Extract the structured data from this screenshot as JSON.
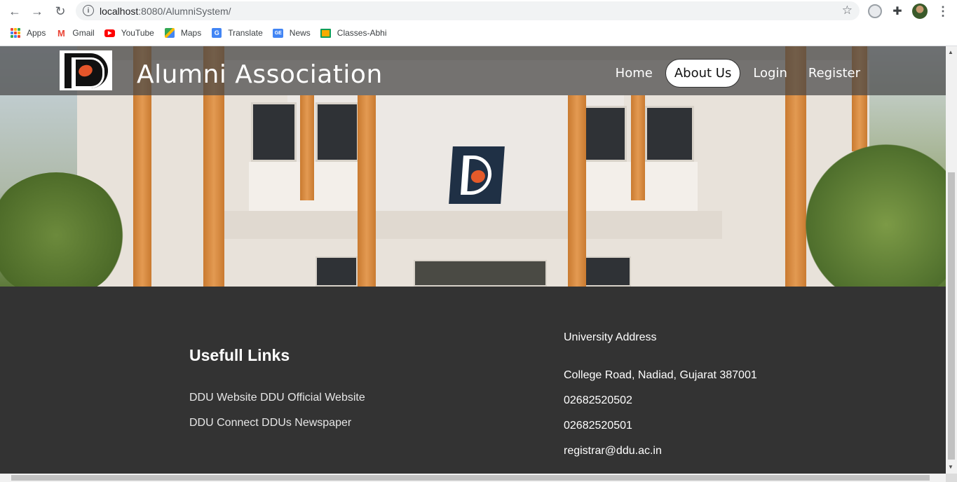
{
  "browser": {
    "url_host": "localhost",
    "url_rest": ":8080/AlumniSystem/",
    "bookmarks": [
      {
        "label": "Apps",
        "icon": "apps-grid-icon"
      },
      {
        "label": "Gmail",
        "icon": "gmail-icon"
      },
      {
        "label": "YouTube",
        "icon": "youtube-icon"
      },
      {
        "label": "Maps",
        "icon": "maps-icon"
      },
      {
        "label": "Translate",
        "icon": "translate-icon"
      },
      {
        "label": "News",
        "icon": "news-icon"
      },
      {
        "label": "Classes-Abhi",
        "icon": "classroom-icon"
      }
    ]
  },
  "header": {
    "title": "Alumni Association",
    "nav": [
      {
        "label": "Home",
        "active": false
      },
      {
        "label": "About Us",
        "active": true
      },
      {
        "label": "Login",
        "active": false
      },
      {
        "label": "Register",
        "active": false
      }
    ]
  },
  "footer": {
    "links_title": "Usefull Links",
    "links": [
      "DDU Website DDU Official Website",
      "DDU Connect DDUs Newspaper"
    ],
    "address_title": "University Address",
    "address": "College Road, Nadiad, Gujarat 387001",
    "phone1": "02682520502",
    "phone2": "02682520501",
    "email": "registrar@ddu.ac.in"
  },
  "colors": {
    "navbar_overlay": "#464646",
    "footer_bg": "#333333",
    "accent_orange": "#e39a52"
  }
}
